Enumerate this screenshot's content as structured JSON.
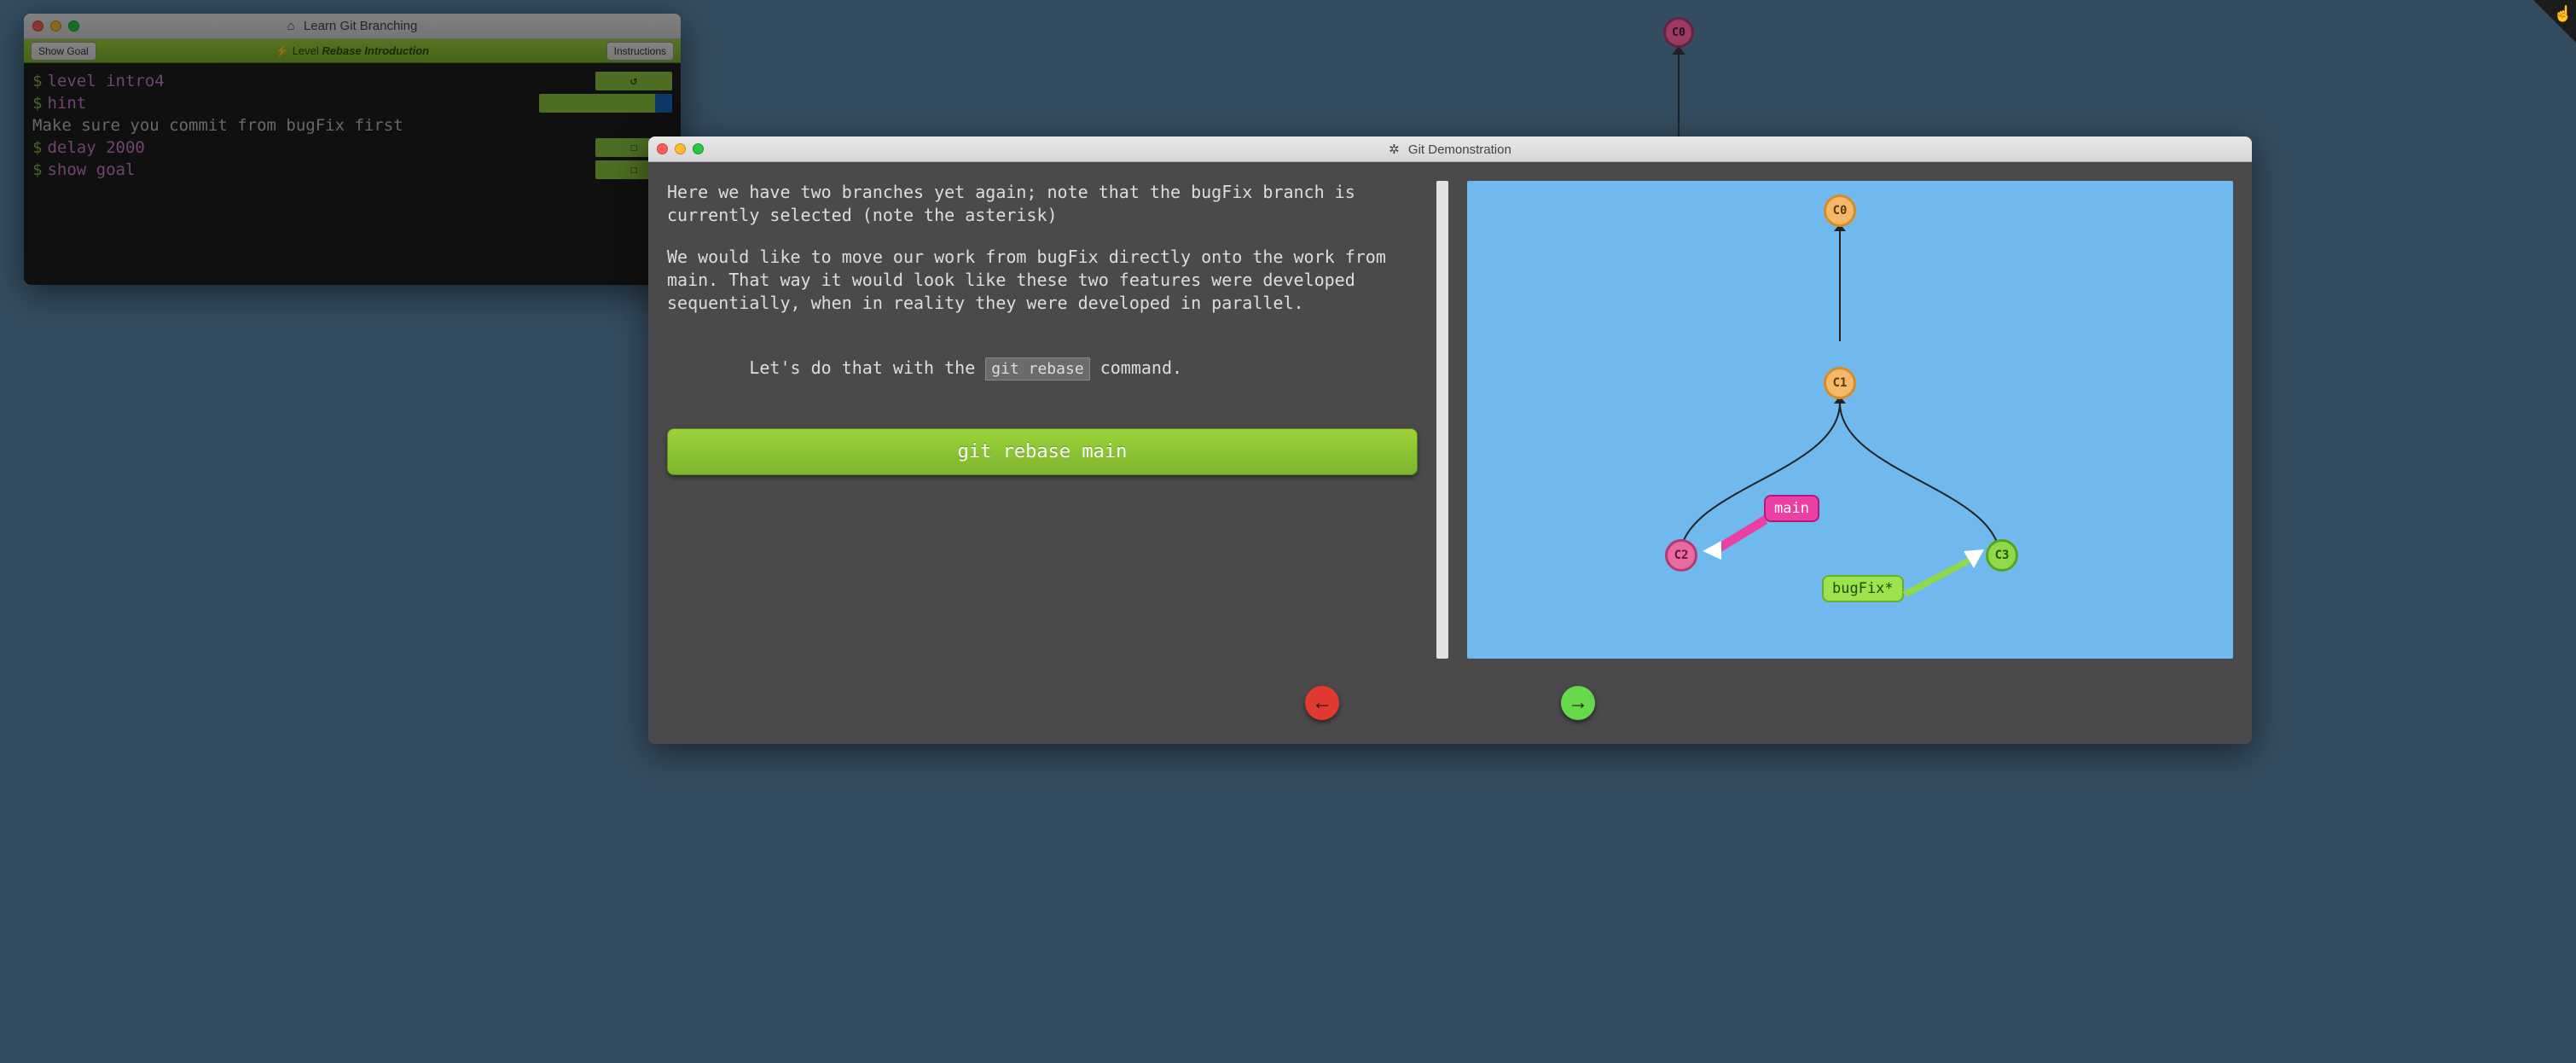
{
  "backWindow": {
    "title": "Learn Git Branching",
    "toolbar": {
      "showGoal": "Show Goal",
      "instructions": "Instructions",
      "levelPrefix": "Level",
      "levelName": "Rebase Introduction"
    },
    "terminal": {
      "lines": [
        {
          "type": "cmd",
          "text": "level intro4",
          "badge": "retweet"
        },
        {
          "type": "cmd",
          "text": "hint",
          "badge": "blue"
        },
        {
          "type": "out",
          "text": "Make sure you commit from bugFix first"
        },
        {
          "type": "cmd",
          "text": "delay 2000",
          "badge": "box"
        },
        {
          "type": "cmd",
          "text": "show goal",
          "badge": "box"
        }
      ]
    }
  },
  "bgNode": {
    "label": "C0"
  },
  "modal": {
    "title": "Git Demonstration",
    "paragraphs": [
      "Here we have two branches yet again; note that the bugFix branch is currently selected (note the asterisk)",
      "We would like to move our work from bugFix directly onto the work from main. That way it would look like these two features were developed sequentially, when in reality they were developed in parallel."
    ],
    "inlineSentence": {
      "before": "Let's do that with the ",
      "code": "git rebase",
      "after": " command."
    },
    "runButton": "git rebase main",
    "diagram": {
      "commits": {
        "c0": "C0",
        "c1": "C1",
        "c2": "C2",
        "c3": "C3"
      },
      "branches": {
        "main": "main",
        "bugfix": "bugFix*"
      }
    }
  },
  "nav": {
    "prev": "←",
    "next": "→"
  }
}
